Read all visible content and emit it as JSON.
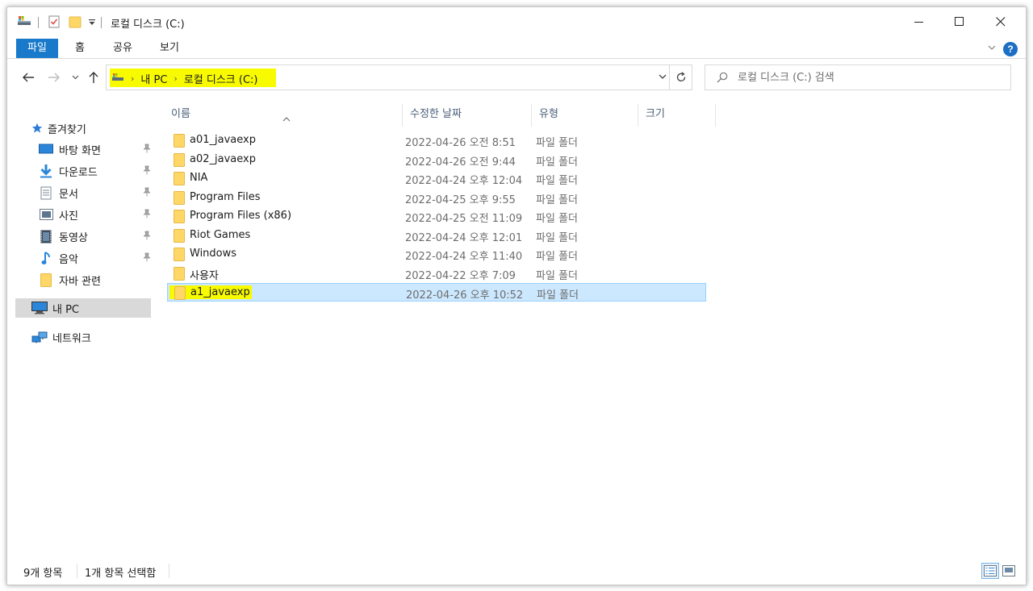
{
  "window": {
    "title": "로컬 디스크 (C:)",
    "controls": {
      "minimize": "minimize-icon",
      "maximize": "maximize-icon",
      "close": "close-icon"
    }
  },
  "ribbon": {
    "tabs": [
      {
        "label": "파일"
      },
      {
        "label": "홈"
      },
      {
        "label": "공유"
      },
      {
        "label": "보기"
      }
    ],
    "help_label": "?"
  },
  "address_bar": {
    "crumbs": [
      "내 PC",
      "로컬 디스크 (C:)"
    ]
  },
  "search": {
    "placeholder": "로컬 디스크 (C:) 검색"
  },
  "sidebar": {
    "quick_access_label": "즐겨찾기",
    "items": [
      {
        "label": "바탕 화면",
        "icon": "desktop-icon",
        "pinned": true
      },
      {
        "label": "다운로드",
        "icon": "download-icon",
        "pinned": true
      },
      {
        "label": "문서",
        "icon": "document-icon",
        "pinned": true
      },
      {
        "label": "사진",
        "icon": "pictures-icon",
        "pinned": true
      },
      {
        "label": "동영상",
        "icon": "videos-icon",
        "pinned": true
      },
      {
        "label": "음악",
        "icon": "music-icon",
        "pinned": true
      },
      {
        "label": "자바 관련",
        "icon": "folder-icon",
        "pinned": false
      }
    ],
    "this_pc_label": "내 PC",
    "network_label": "네트워크"
  },
  "columns": {
    "name": "이름",
    "date": "수정한 날짜",
    "type": "유형",
    "size": "크기"
  },
  "files": [
    {
      "name": "a01_javaexp",
      "date": "2022-04-26 오전 8:51",
      "type": "파일 폴더"
    },
    {
      "name": "a02_javaexp",
      "date": "2022-04-26 오전 9:44",
      "type": "파일 폴더"
    },
    {
      "name": "NIA",
      "date": "2022-04-24 오후 12:04",
      "type": "파일 폴더"
    },
    {
      "name": "Program Files",
      "date": "2022-04-25 오후 9:55",
      "type": "파일 폴더"
    },
    {
      "name": "Program Files (x86)",
      "date": "2022-04-25 오전 11:09",
      "type": "파일 폴더"
    },
    {
      "name": "Riot Games",
      "date": "2022-04-24 오후 12:01",
      "type": "파일 폴더"
    },
    {
      "name": "Windows",
      "date": "2022-04-24 오후 11:40",
      "type": "파일 폴더"
    },
    {
      "name": "사용자",
      "date": "2022-04-22 오후 7:09",
      "type": "파일 폴더"
    },
    {
      "name": "a1_javaexp",
      "date": "2022-04-26 오후 10:52",
      "type": "파일 폴더",
      "selected": true
    }
  ],
  "status": {
    "item_count": "9개 항목",
    "selection": "1개 항목 선택함"
  },
  "colors": {
    "accent": "#1979ca",
    "selection": "#cce8ff",
    "highlight": "#f8fb00",
    "folder": "#ffd767"
  }
}
